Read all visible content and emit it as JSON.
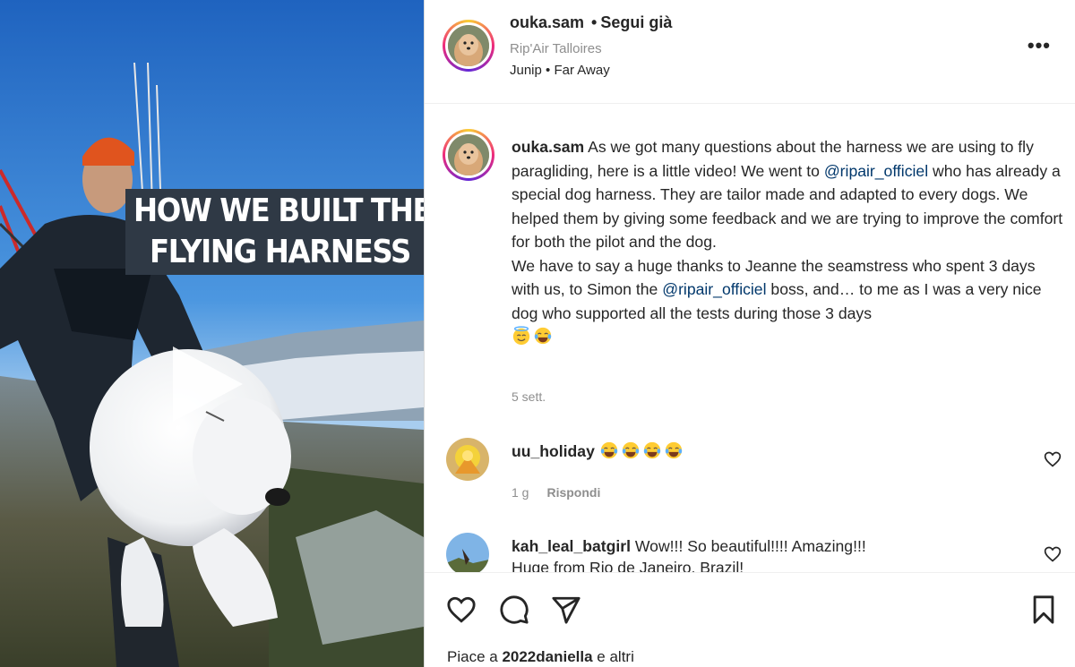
{
  "media": {
    "caption_line1": "HOW WE BUILT THE",
    "caption_line2": "FLYING HARNESS",
    "play_icon": "play-icon"
  },
  "header": {
    "username": "ouka.sam",
    "separator": "•",
    "follow_status": "Segui già",
    "location": "Rip'Air Talloires",
    "audio_artist": "Junip",
    "audio_sep": "•",
    "audio_track": "Far Away",
    "more_icon": "more-options-icon"
  },
  "caption": {
    "username": "ouka.sam",
    "text_1": " As we got many questions about the harness we are using to fly paragliding, here is a little video! We went to ",
    "mention_1": "@ripair_officiel",
    "text_2": " who has already a special dog harness. They are tailor made and adapted to every dogs. We helped them by giving some feedback and we are trying to improve the comfort for both the pilot and the dog.",
    "text_3": "We have to say a huge thanks to Jeanne the seamstress who spent 3 days with us, to Simon the ",
    "mention_2": "@ripair_officiel",
    "text_4": " boss, and… to me as I was a very nice dog who supported all the tests during those 3 days",
    "emojis": [
      "smiling-face-with-halo",
      "face-with-tears-of-joy"
    ],
    "time": "5 sett."
  },
  "comments": [
    {
      "username": "uu_holiday",
      "text": "",
      "emojis": [
        "face-with-tears-of-joy",
        "face-with-tears-of-joy",
        "face-with-tears-of-joy",
        "face-with-tears-of-joy"
      ],
      "time": "1 g",
      "reply_label": "Rispondi"
    },
    {
      "username": "kah_leal_batgirl",
      "text": "Wow!!! So beautiful!!!! Amazing!!!",
      "text_2": "Huge from Rio de Janeiro, Brazil!"
    }
  ],
  "actions": {
    "like_icon": "heart-icon",
    "comment_icon": "comment-icon",
    "share_icon": "share-icon",
    "save_icon": "bookmark-icon"
  },
  "likes": {
    "prefix": "Piace a ",
    "user": "2022daniella",
    "suffix": " e altri"
  },
  "colors": {
    "link": "#00376b",
    "muted": "#8e8e8e",
    "text": "#262626"
  }
}
